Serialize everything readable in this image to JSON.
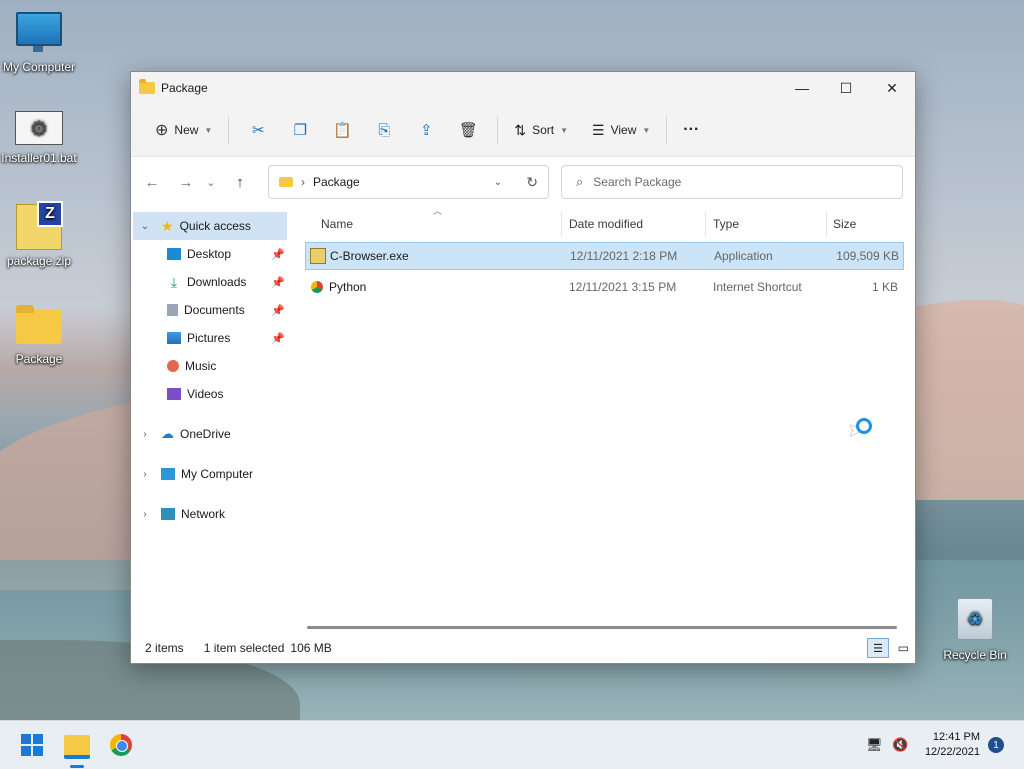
{
  "desktop": {
    "icons": [
      {
        "label": "My Computer"
      },
      {
        "label": "Installer01.bat"
      },
      {
        "label": "package.zip"
      },
      {
        "label": "Package"
      },
      {
        "label": "Recycle Bin"
      }
    ]
  },
  "window": {
    "title": "Package",
    "controls": {
      "minimize": "—",
      "maximize": "☐",
      "close": "✕"
    }
  },
  "toolbar": {
    "new_label": "New",
    "sort_label": "Sort",
    "view_label": "View",
    "more_label": "···",
    "icons": [
      "cut-icon",
      "copy-icon",
      "paste-icon",
      "rename-icon",
      "share-icon",
      "delete-icon"
    ]
  },
  "address": {
    "back": "←",
    "forward": "→",
    "history": "⌄",
    "up": "↑",
    "separator": "›",
    "path": "Package",
    "search_placeholder": "Search Package"
  },
  "nav": {
    "quick_access": "Quick access",
    "quick_items": [
      {
        "label": "Desktop",
        "pinned": true
      },
      {
        "label": "Downloads",
        "pinned": true
      },
      {
        "label": "Documents",
        "pinned": true
      },
      {
        "label": "Pictures",
        "pinned": true
      },
      {
        "label": "Music",
        "pinned": false
      },
      {
        "label": "Videos",
        "pinned": false
      }
    ],
    "roots": [
      {
        "label": "OneDrive"
      },
      {
        "label": "My Computer"
      },
      {
        "label": "Network"
      }
    ]
  },
  "content": {
    "columns": {
      "name": "Name",
      "date": "Date modified",
      "type": "Type",
      "size": "Size"
    },
    "files": [
      {
        "name": "C-Browser.exe",
        "date": "12/11/2021 2:18 PM",
        "type": "Application",
        "size": "109,509 KB",
        "selected": true
      },
      {
        "name": "Python",
        "date": "12/11/2021 3:15 PM",
        "type": "Internet Shortcut",
        "size": "1 KB",
        "selected": false
      }
    ]
  },
  "status": {
    "items": "2 items",
    "selected": "1 item selected",
    "size": "106 MB"
  },
  "taskbar": {
    "time": "12:41 PM",
    "date": "12/22/2021",
    "notifications": "1"
  },
  "colors": {
    "accent": "#1a7ad6",
    "selection": "#cce4f7",
    "folder": "#f6c945"
  }
}
